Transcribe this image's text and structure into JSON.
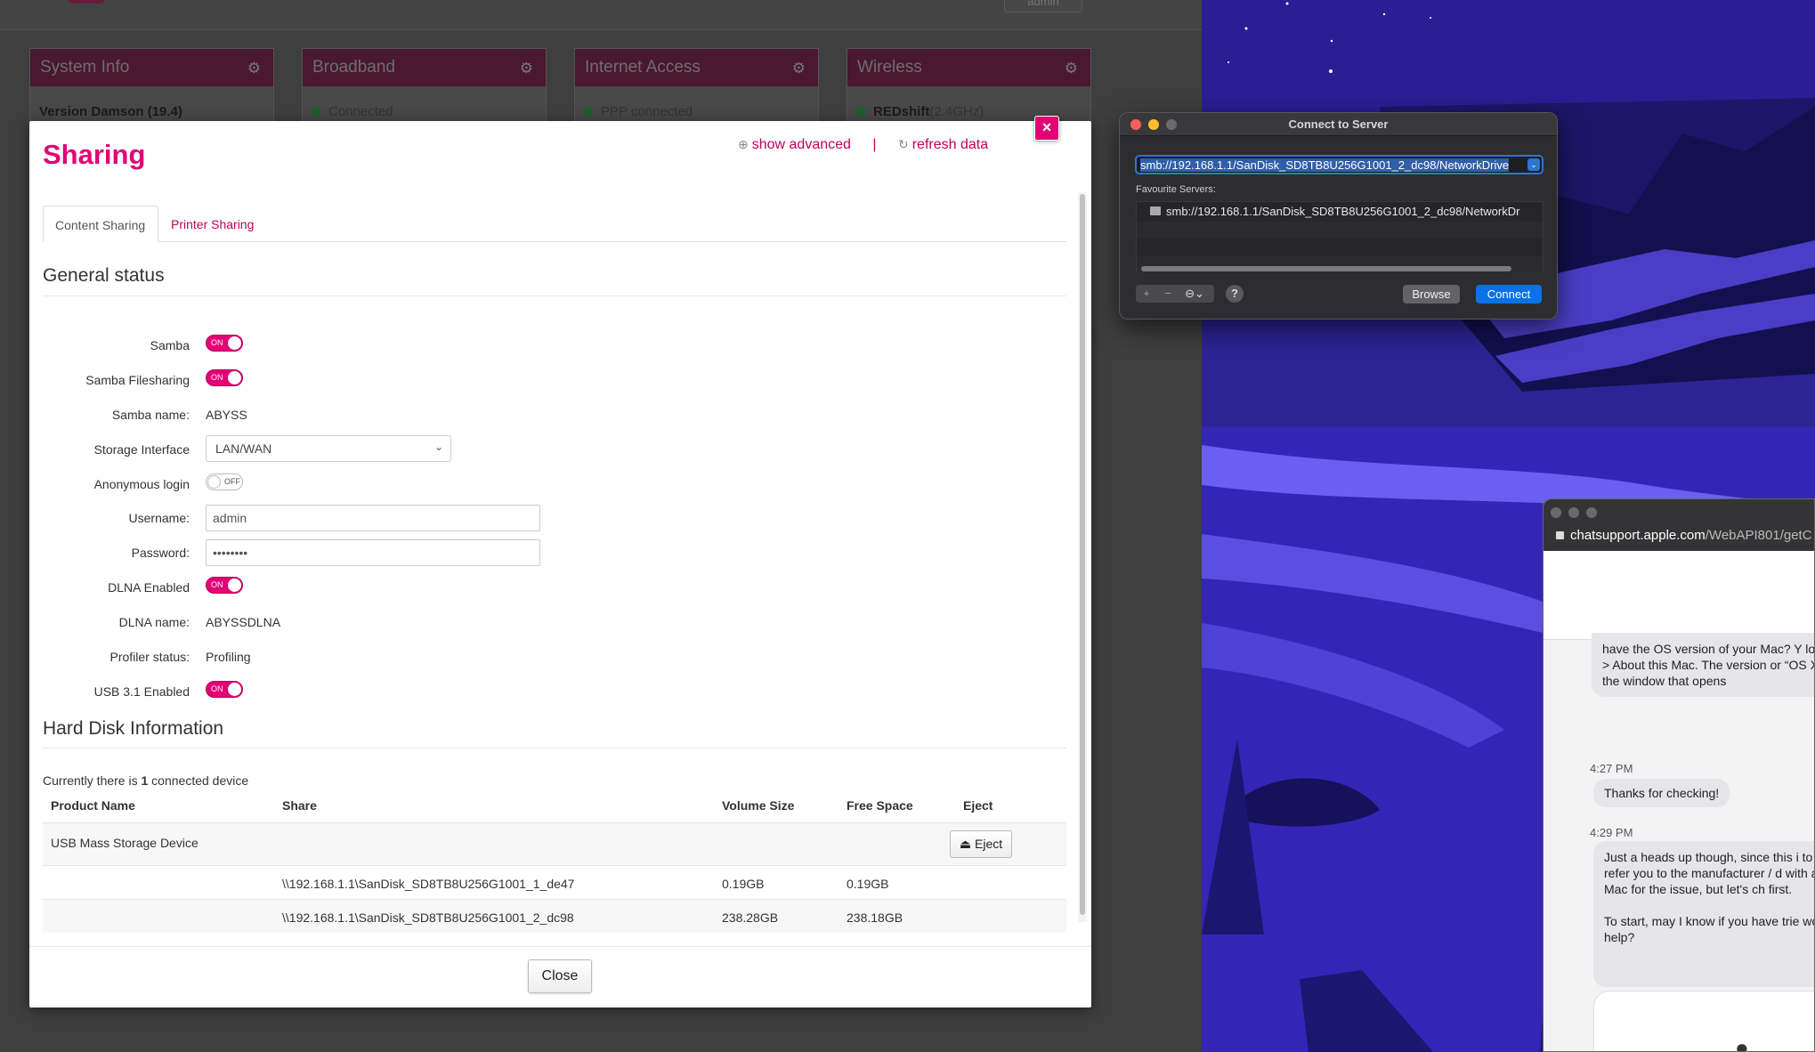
{
  "router": {
    "user_label": "admin",
    "widgets": [
      {
        "title": "System Info",
        "text_bold": "Version Damson (19.4)",
        "text": ""
      },
      {
        "title": "Broadband",
        "text_bold": "",
        "text": "Connected"
      },
      {
        "title": "Internet Access",
        "text_bold": "",
        "text": "PPP connected"
      },
      {
        "title": "Wireless",
        "text_bold": "REDshift",
        "text": "(2.4GHz)"
      }
    ]
  },
  "modal": {
    "title": "Sharing",
    "close_x": "×",
    "show_advanced": "show advanced",
    "separator": "|",
    "refresh_data": "refresh data",
    "tabs": {
      "content": "Content Sharing",
      "printer": "Printer Sharing"
    },
    "general_status": "General status",
    "labels": {
      "samba": "Samba",
      "samba_filesharing": "Samba Filesharing",
      "samba_name": "Samba name:",
      "storage_interface": "Storage Interface",
      "anonymous_login": "Anonymous login",
      "username": "Username:",
      "password": "Password:",
      "dlna_enabled": "DLNA Enabled",
      "dlna_name": "DLNA name:",
      "profiler_status": "Profiler status:",
      "usb31": "USB 3.1 Enabled"
    },
    "toggle_on": "ON",
    "toggle_off": "OFF",
    "values": {
      "samba": true,
      "samba_filesharing": true,
      "samba_name": "ABYSS",
      "storage_interface": "LAN/WAN",
      "anonymous_login": false,
      "username": "admin",
      "password": "••••••••",
      "dlna_enabled": true,
      "dlna_name": "ABYSSDLNA",
      "profiler_status": "Profiling",
      "usb31": true
    },
    "hard_disk_title": "Hard Disk Information",
    "connected_prefix": "Currently there is ",
    "connected_count": "1",
    "connected_suffix": " connected device",
    "columns": [
      "Product Name",
      "Share",
      "Volume Size",
      "Free Space",
      "Eject"
    ],
    "device": {
      "name": "USB Mass Storage Device",
      "eject_label": "Eject"
    },
    "shares": [
      {
        "path": "\\\\192.168.1.1\\SanDisk_SD8TB8U256G1001_1_de47",
        "volume": "0.19GB",
        "free": "0.19GB"
      },
      {
        "path": "\\\\192.168.1.1\\SanDisk_SD8TB8U256G1001_2_dc98",
        "volume": "238.28GB",
        "free": "238.18GB"
      }
    ],
    "close_button": "Close"
  },
  "connect_to_server": {
    "title": "Connect to Server",
    "address": "smb://192.168.1.1/SanDisk_SD8TB8U256G1001_2_dc98/NetworkDrive",
    "favourites_label": "Favourite Servers:",
    "favourites": [
      "smb://192.168.1.1/SanDisk_SD8TB8U256G1001_2_dc98/NetworkDr"
    ],
    "browse": "Browse",
    "connect": "Connect",
    "help": "?",
    "add": "+",
    "remove": "−",
    "more": "⊖⌄"
  },
  "chat": {
    "url_bold": "chatsupport.apple.com",
    "url_rest": "/WebAPI801/getC",
    "msg1": "have the OS version of your Mac? Y logo > About this Mac. The version or “OS X” in the window that opens",
    "time1": "4:27 PM",
    "msg2": "Thanks for checking!",
    "time2": "4:29 PM",
    "msg3": "Just a heads up though, since this i to refer you to the manufacturer / d with a Mac for the issue, but let's ch first.",
    "msg4": "To start, may I know if you have trie would help?"
  },
  "colors": {
    "accent": "#e20074",
    "mac_blue": "#2f74d0"
  }
}
